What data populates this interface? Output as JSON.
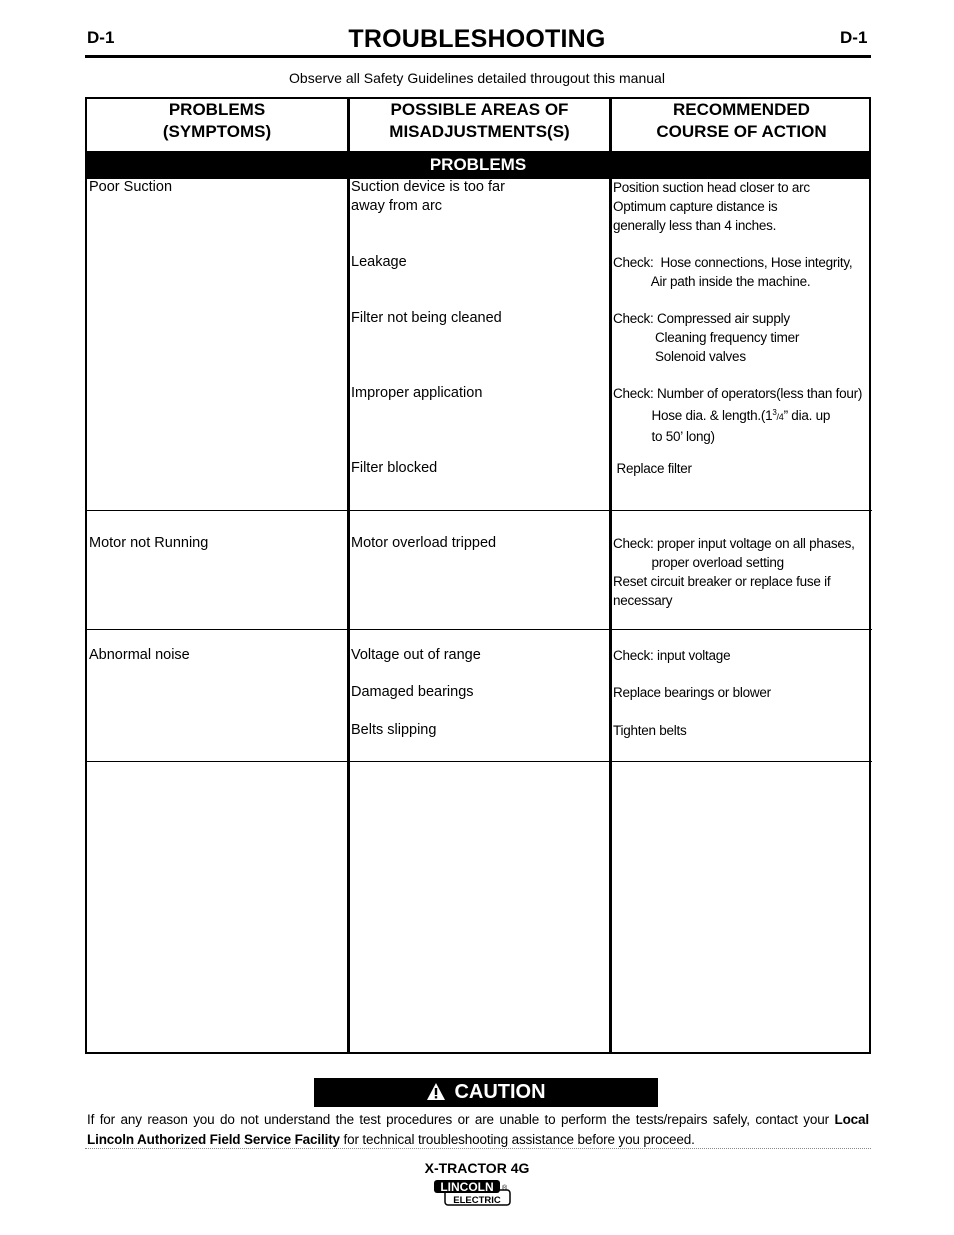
{
  "page": {
    "code_left": "D-1",
    "code_right": "D-1",
    "title": "TROUBLESHOOTING",
    "safety_note": "Observe all Safety Guidelines detailed througout this manual"
  },
  "table": {
    "headers": [
      {
        "line1": "PROBLEMS",
        "line2": "(SYMPTOMS)"
      },
      {
        "line1": "POSSIBLE AREAS OF",
        "line2": "MISADJUSTMENTS(S)"
      },
      {
        "line1": "RECOMMENDED",
        "line2": "COURSE OF ACTION"
      }
    ],
    "section_label": "PROBLEMS",
    "rows": [
      {
        "symptom": "Poor Suction",
        "causes": [
          {
            "cause": "Suction device is too far\naway from arc",
            "action": "Position suction head closer to arc\nOptimum capture distance is\ngenerally less than 4 inches."
          },
          {
            "cause": "Leakage",
            "action": "Check:  Hose connections, Hose integrity,\n           Air path inside the machine."
          },
          {
            "cause": "Filter not being cleaned",
            "action": "Check: Compressed air supply\n            Cleaning frequency timer\n            Solenoid valves"
          },
          {
            "cause": "Improper application",
            "action_line1": "Check: Number of operators(less than four)",
            "action_line2_pre": "           Hose dia. & length.(1",
            "action_sup": "3",
            "action_frac": "/4",
            "action_line2_post": "” dia. up",
            "action_line3": "           to 50’ long)"
          },
          {
            "cause": "Filter blocked",
            "action": " Replace filter"
          }
        ]
      },
      {
        "symptom": "Motor not Running",
        "causes": [
          {
            "cause": "Motor overload tripped",
            "action": "Check: proper input voltage on all phases,\n           proper overload setting\nReset circuit breaker or replace fuse if\nnecessary"
          }
        ]
      },
      {
        "symptom": "Abnormal noise",
        "causes": [
          {
            "cause": "Voltage out of range",
            "action": "Check: input voltage"
          },
          {
            "cause": "Damaged bearings",
            "action": "Replace bearings or blower"
          },
          {
            "cause": "Belts slipping",
            "action": "Tighten belts"
          }
        ]
      }
    ]
  },
  "caution": {
    "icon": "warning-triangle-icon",
    "label": "CAUTION",
    "text_pre": "If for any reason you do not understand the test procedures or are unable to perform the tests/repairs safely, contact your ",
    "text_bold": "Local  Lincoln Authorized Field Service Facility",
    "text_post": " for technical troubleshooting assistance before you proceed."
  },
  "footer": {
    "product_name": "X-TRACTOR 4G",
    "logo_top": "LINCOLN",
    "logo_bottom": "ELECTRIC",
    "logo_mark": "®"
  }
}
